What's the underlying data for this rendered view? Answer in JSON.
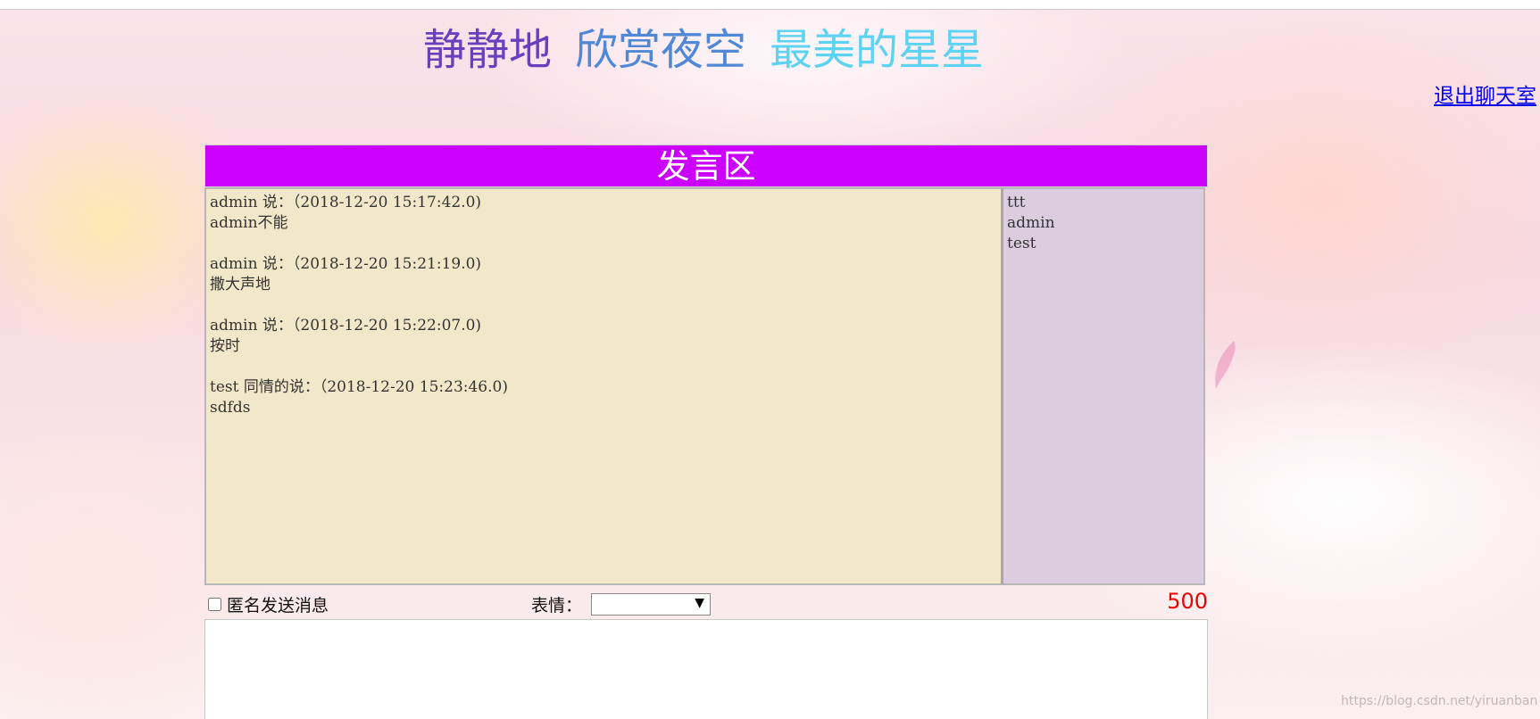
{
  "header": {
    "title_parts": [
      "静静地",
      "欣赏夜空",
      "最美的星星"
    ],
    "title_colors": [
      "#6a3fbf",
      "#4f88d6",
      "#5dd3f3"
    ],
    "logout_label": "退出聊天室"
  },
  "chat": {
    "header_title": "发言区",
    "messages": [
      {
        "meta": "admin 说：（2018-12-20 15:17:42.0)",
        "text": "admin不能"
      },
      {
        "meta": "admin 说：（2018-12-20 15:21:19.0)",
        "text": "撒大声地"
      },
      {
        "meta": "admin 说：（2018-12-20 15:22:07.0)",
        "text": "按时"
      },
      {
        "meta": "test 同情的说：（2018-12-20 15:23:46.0)",
        "text": "sdfds"
      }
    ],
    "online_users": [
      "ttt",
      "admin",
      "test"
    ]
  },
  "controls": {
    "anonymous_label": "匿名发送消息",
    "anonymous_checked": false,
    "emotion_label": "表情：",
    "emotion_selected": "",
    "char_remaining": "500"
  },
  "watermark": "https://blog.csdn.net/yiruanban",
  "colors": {
    "header_bg": "#cc00ff",
    "message_bg": "#f2e8c9",
    "user_list_bg": "#dccce0",
    "counter": "#ee0000",
    "link": "#0000ee"
  }
}
